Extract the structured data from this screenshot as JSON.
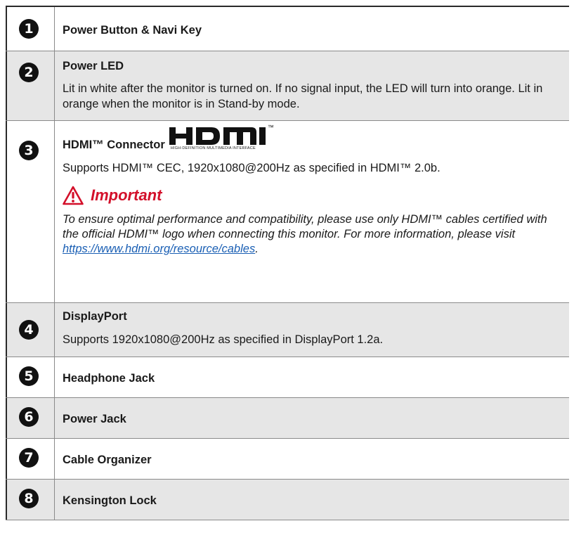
{
  "items": [
    {
      "num": "1",
      "title": "Power Button & Navi Key"
    },
    {
      "num": "2",
      "title": "Power LED",
      "desc": "Lit in white after the monitor is turned on. If no signal input, the LED will turn into orange. Lit in orange when the monitor is in Stand-by mode."
    },
    {
      "num": "3",
      "title": "HDMI™ Connector",
      "logo_sub": "HIGH-DEFINITION MULTIMEDIA INTERFACE",
      "logo_tm": "™",
      "desc": "Supports HDMI™ CEC, 1920x1080@200Hz as specified in HDMI™ 2.0b.",
      "important_label": "Important",
      "important_text": "To ensure optimal performance and compatibility, please use only HDMI™ cables certified with the official HDMI™ logo when connecting this monitor. For more information, please visit ",
      "important_link": "https://www.hdmi.org/resource/cables",
      "important_tail": "."
    },
    {
      "num": "4",
      "title": "DisplayPort",
      "desc": "Supports 1920x1080@200Hz as specified in DisplayPort 1.2a."
    },
    {
      "num": "5",
      "title": "Headphone Jack"
    },
    {
      "num": "6",
      "title": "Power Jack"
    },
    {
      "num": "7",
      "title": "Cable Organizer"
    },
    {
      "num": "8",
      "title": "Kensington Lock"
    }
  ],
  "colors": {
    "important": "#d3102a",
    "link": "#1a5fb4",
    "row_gray": "#e6e6e6"
  },
  "icons": {
    "warning": "warning-icon",
    "logo": "hdmi-logo"
  }
}
